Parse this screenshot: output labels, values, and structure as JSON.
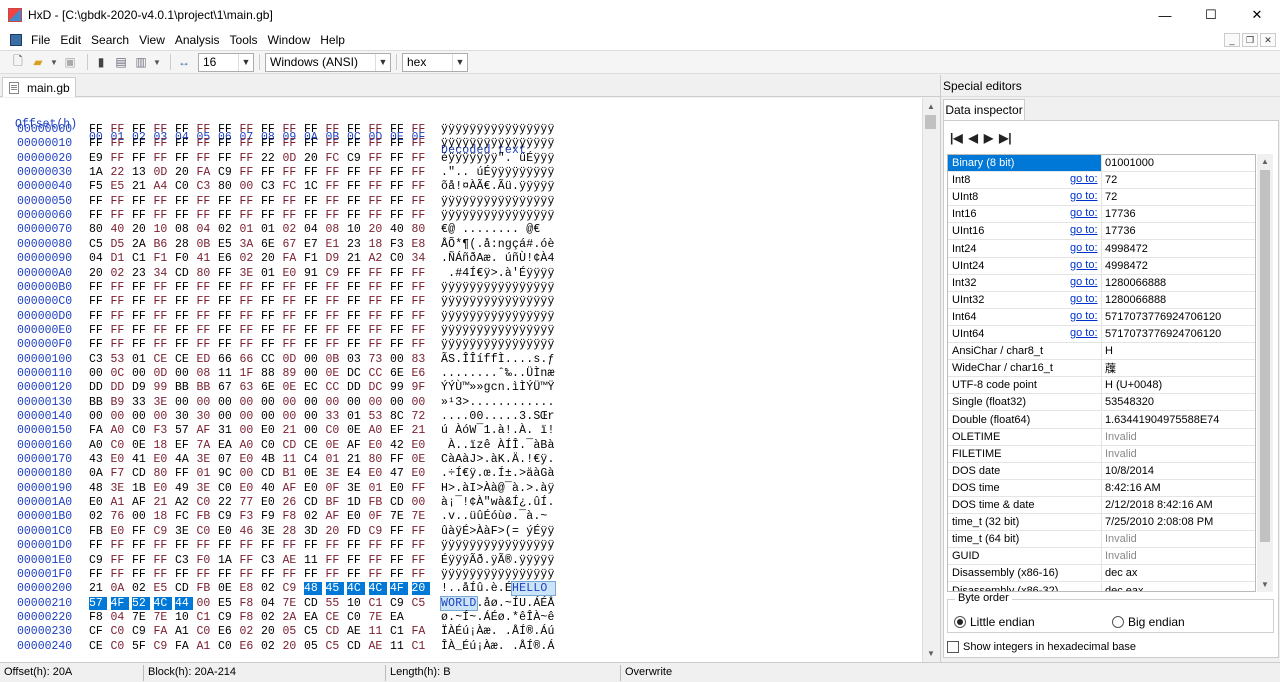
{
  "title": "HxD - [C:\\gbdk-2020-v4.0.1\\project\\1\\main.gb]",
  "window_buttons": {
    "minimize": "—",
    "maximize": "☐",
    "close": "✕"
  },
  "menu": [
    "File",
    "Edit",
    "Search",
    "View",
    "Analysis",
    "Tools",
    "Window",
    "Help"
  ],
  "toolbar": {
    "bytes_per_row": "16",
    "charset": "Windows (ANSI)",
    "offset_base": "hex"
  },
  "tab": {
    "label": "main.gb"
  },
  "hex": {
    "offset_header": "Offset(h)",
    "columns": [
      "00",
      "01",
      "02",
      "03",
      "04",
      "05",
      "06",
      "07",
      "08",
      "09",
      "0A",
      "0B",
      "0C",
      "0D",
      "0E",
      "0F"
    ],
    "decoded_header": "Decoded text",
    "rows": [
      {
        "offset": "00000000",
        "bytes": "FF FF FF FF FF FF FF FF FF FF FF FF FF FF FF FF",
        "text": "ÿÿÿÿÿÿÿÿÿÿÿÿÿÿÿÿ"
      },
      {
        "offset": "00000010",
        "bytes": "FF FF FF FF FF FF FF FF FF FF FF FF FF FF FF FF",
        "text": "ÿÿÿÿÿÿÿÿÿÿÿÿÿÿÿÿ"
      },
      {
        "offset": "00000020",
        "bytes": "E9 FF FF FF FF FF FF FF 22 0D 20 FC C9 FF FF FF",
        "text": "éÿÿÿÿÿÿÿ\". üÉÿÿÿ"
      },
      {
        "offset": "00000030",
        "bytes": "1A 22 13 0D 20 FA C9 FF FF FF FF FF FF FF FF FF",
        "text": ".\".. úÉÿÿÿÿÿÿÿÿÿ"
      },
      {
        "offset": "00000040",
        "bytes": "F5 E5 21 A4 C0 C3 80 00 C3 FC 1C FF FF FF FF FF",
        "text": "õå!¤ÀÃ€.Ãü.ÿÿÿÿÿ"
      },
      {
        "offset": "00000050",
        "bytes": "FF FF FF FF FF FF FF FF FF FF FF FF FF FF FF FF",
        "text": "ÿÿÿÿÿÿÿÿÿÿÿÿÿÿÿÿ"
      },
      {
        "offset": "00000060",
        "bytes": "FF FF FF FF FF FF FF FF FF FF FF FF FF FF FF FF",
        "text": "ÿÿÿÿÿÿÿÿÿÿÿÿÿÿÿÿ"
      },
      {
        "offset": "00000070",
        "bytes": "80 40 20 10 08 04 02 01 01 02 04 08 10 20 40 80",
        "text": "€@ ........ @€"
      },
      {
        "offset": "00000080",
        "bytes": "C5 D5 2A B6 28 0B E5 3A 6E 67 E7 E1 23 18 F3 E8",
        "text": "ÅÕ*¶(.å:ngçá#.óè"
      },
      {
        "offset": "00000090",
        "bytes": "04 D1 C1 F1 F0 41 E6 02 20 FA F1 D9 21 A2 C0 34",
        "text": ".ÑÁñðAæ. úñÙ!¢À4"
      },
      {
        "offset": "000000A0",
        "bytes": "20 02 23 34 CD 80 FF 3E 01 E0 91 C9 FF FF FF FF",
        "text": " .#4Í€ÿ>.à'Éÿÿÿÿ"
      },
      {
        "offset": "000000B0",
        "bytes": "FF FF FF FF FF FF FF FF FF FF FF FF FF FF FF FF",
        "text": "ÿÿÿÿÿÿÿÿÿÿÿÿÿÿÿÿ"
      },
      {
        "offset": "000000C0",
        "bytes": "FF FF FF FF FF FF FF FF FF FF FF FF FF FF FF FF",
        "text": "ÿÿÿÿÿÿÿÿÿÿÿÿÿÿÿÿ"
      },
      {
        "offset": "000000D0",
        "bytes": "FF FF FF FF FF FF FF FF FF FF FF FF FF FF FF FF",
        "text": "ÿÿÿÿÿÿÿÿÿÿÿÿÿÿÿÿ"
      },
      {
        "offset": "000000E0",
        "bytes": "FF FF FF FF FF FF FF FF FF FF FF FF FF FF FF FF",
        "text": "ÿÿÿÿÿÿÿÿÿÿÿÿÿÿÿÿ"
      },
      {
        "offset": "000000F0",
        "bytes": "FF FF FF FF FF FF FF FF FF FF FF FF FF FF FF FF",
        "text": "ÿÿÿÿÿÿÿÿÿÿÿÿÿÿÿÿ"
      },
      {
        "offset": "00000100",
        "bytes": "C3 53 01 CE CE ED 66 66 CC 0D 00 0B 03 73 00 83",
        "text": "ÃS.ÎÎíffÌ....s.ƒ"
      },
      {
        "offset": "00000110",
        "bytes": "00 0C 00 0D 00 08 11 1F 88 89 00 0E DC CC 6E E6",
        "text": "........ˆ‰..ÜÌnæ"
      },
      {
        "offset": "00000120",
        "bytes": "DD DD D9 99 BB BB 67 63 6E 0E EC CC DD DC 99 9F",
        "text": "ÝÝÙ™»»gcn.ìÌÝÜ™Ÿ"
      },
      {
        "offset": "00000130",
        "bytes": "BB B9 33 3E 00 00 00 00 00 00 00 00 00 00 00 00",
        "text": "»¹3>............"
      },
      {
        "offset": "00000140",
        "bytes": "00 00 00 00 30 30 00 00 00 00 00 33 01 53 8C 72",
        "text": "....00.....3.SŒr"
      },
      {
        "offset": "00000150",
        "bytes": "FA A0 C0 F3 57 AF 31 00 E0 21 00 C0 0E A0 EF 21",
        "text": "ú ÀóW¯1.à!.À. ï!"
      },
      {
        "offset": "00000160",
        "bytes": "A0 C0 0E 18 EF 7A EA A0 C0 CD CE 0E AF E0 42 E0",
        "text": " À..ïzê ÀÍÎ.¯àBà"
      },
      {
        "offset": "00000170",
        "bytes": "43 E0 41 E0 4A 3E 07 E0 4B 11 C4 01 21 80 FF 0E",
        "text": "CàAàJ>.àK.Ä.!€ÿ."
      },
      {
        "offset": "00000180",
        "bytes": "0A F7 CD 80 FF 01 9C 00 CD B1 0E 3E E4 E0 47 E0",
        "text": ".÷Í€ÿ.œ.Í±.>äàGà"
      },
      {
        "offset": "00000190",
        "bytes": "48 3E 1B E0 49 3E C0 E0 40 AF E0 0F 3E 01 E0 FF",
        "text": "H>.àI>Àà@¯à.>.àÿ"
      },
      {
        "offset": "000001A0",
        "bytes": "E0 A1 AF 21 A2 C0 22 77 E0 26 CD BF 1D FB CD 00",
        "text": "à¡¯!¢À\"wà&Í¿.ûÍ."
      },
      {
        "offset": "000001B0",
        "bytes": "02 76 00 18 FC FB C9 F3 F9 F8 02 AF E0 0F 7E 7E",
        "text": ".v..üûÉóùø.¯à.~"
      },
      {
        "offset": "000001C0",
        "bytes": "FB E0 FF C9 3E C0 E0 46 3E 28 3D 20 FD C9 FF FF",
        "text": "ûàÿÉ>ÀàF>(= ýÉÿÿ"
      },
      {
        "offset": "000001D0",
        "bytes": "FF FF FF FF FF FF FF FF FF FF FF FF FF FF FF FF",
        "text": "ÿÿÿÿÿÿÿÿÿÿÿÿÿÿÿÿ"
      },
      {
        "offset": "000001E0",
        "bytes": "C9 FF FF FF C3 F0 1A FF C3 AE 11 FF FF FF FF FF",
        "text": "ÉÿÿÿÃð.ÿÃ®.ÿÿÿÿÿ"
      },
      {
        "offset": "000001F0",
        "bytes": "FF FF FF FF FF FF FF FF FF FF FF FF FF FF FF FF",
        "text": "ÿÿÿÿÿÿÿÿÿÿÿÿÿÿÿÿ"
      },
      {
        "offset": "00000200",
        "bytes": "21 0A 02 E5 CD FB 0E E8 02 C9 48 45 4C 4C 4F 20",
        "text": "!..åÍû.è.É",
        "text_sel": "HELLO "
      },
      {
        "offset": "00000210",
        "bytes": "57 4F 52 4C 44 00 E5 F8 04 7E CD 55 10 C1 C9 C5",
        "text": ".åø.~ÍU.ÁÉÅ",
        "text_sel": "WORLD",
        "sel_first": true
      },
      {
        "offset": "00000220",
        "bytes": "F8 04 7E 7E 10 C1 C9 F8 02 2A EA CE C0 7E EA",
        "text": "ø.~Í~.ÁÉø.*êÎÀ~ê"
      },
      {
        "offset": "00000230",
        "bytes": "CF C0 C9 FA A1 C0 E6 02 20 05 C5 CD AE 11 C1 FA",
        "text": "ÏÀÉú¡Àæ. .ÅÍ®.Áú"
      },
      {
        "offset": "00000240",
        "bytes": "CE C0 5F C9 FA A1 C0 E6 02 20 05 C5 CD AE 11 C1",
        "text": "ÎÀ_Éú¡Àæ. .ÅÍ®.Á"
      }
    ]
  },
  "side": {
    "title": "Special editors",
    "tab": "Data inspector",
    "nav": [
      "|◀",
      "◀",
      "▶",
      "▶|"
    ],
    "goto_label": "go to:",
    "rows": [
      {
        "name": "Binary (8 bit)",
        "value": "01001000",
        "hl": true
      },
      {
        "name": "Int8",
        "value": "72",
        "goto": true
      },
      {
        "name": "UInt8",
        "value": "72",
        "goto": true
      },
      {
        "name": "Int16",
        "value": "17736",
        "goto": true
      },
      {
        "name": "UInt16",
        "value": "17736",
        "goto": true
      },
      {
        "name": "Int24",
        "value": "4998472",
        "goto": true
      },
      {
        "name": "UInt24",
        "value": "4998472",
        "goto": true
      },
      {
        "name": "Int32",
        "value": "1280066888",
        "goto": true
      },
      {
        "name": "UInt32",
        "value": "1280066888",
        "goto": true
      },
      {
        "name": "Int64",
        "value": "5717073776924706120",
        "goto": true
      },
      {
        "name": "UInt64",
        "value": "5717073776924706120",
        "goto": true
      },
      {
        "name": "AnsiChar / char8_t",
        "value": "H"
      },
      {
        "name": "WideChar / char16_t",
        "value": "䕈"
      },
      {
        "name": "UTF-8 code point",
        "value": "H (U+0048)"
      },
      {
        "name": "Single (float32)",
        "value": "53548320"
      },
      {
        "name": "Double (float64)",
        "value": "1.63441904975588E74"
      },
      {
        "name": "OLETIME",
        "value": "Invalid",
        "invalid": true
      },
      {
        "name": "FILETIME",
        "value": "Invalid",
        "invalid": true
      },
      {
        "name": "DOS date",
        "value": "10/8/2014"
      },
      {
        "name": "DOS time",
        "value": "8:42:16 AM"
      },
      {
        "name": "DOS time & date",
        "value": "2/12/2018 8:42:16 AM"
      },
      {
        "name": "time_t (32 bit)",
        "value": "7/25/2010 2:08:08 PM"
      },
      {
        "name": "time_t (64 bit)",
        "value": "Invalid",
        "invalid": true
      },
      {
        "name": "GUID",
        "value": "Invalid",
        "invalid": true
      },
      {
        "name": "Disassembly (x86-16)",
        "value": "dec ax"
      },
      {
        "name": "Disassembly (x86-32)",
        "value": "dec eax"
      }
    ],
    "byte_order_label": "Byte order",
    "little_endian": "Little endian",
    "big_endian": "Big endian",
    "hex_check": "Show integers in hexadecimal base"
  },
  "status": {
    "offset": "Offset(h): 20A",
    "block": "Block(h): 20A-214",
    "length": "Length(h): B",
    "mode": "Overwrite"
  }
}
